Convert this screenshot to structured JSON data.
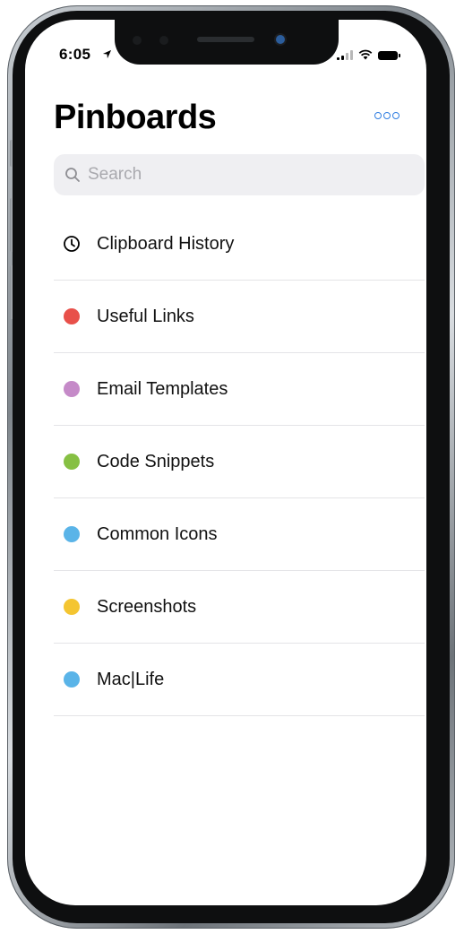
{
  "status_bar": {
    "time": "6:05"
  },
  "header": {
    "title": "Pinboards",
    "more_icon": "ellipsis-circle-icon",
    "accent_color": "#2f7de1"
  },
  "search": {
    "placeholder": "Search",
    "value": ""
  },
  "boards": [
    {
      "label": "Clipboard History",
      "icon": "clock-icon",
      "color": "#000000"
    },
    {
      "label": "Useful Links",
      "icon": "dot",
      "color": "#e8504a"
    },
    {
      "label": "Email Templates",
      "icon": "dot",
      "color": "#c58ac8"
    },
    {
      "label": "Code Snippets",
      "icon": "dot",
      "color": "#86c043"
    },
    {
      "label": "Common Icons",
      "icon": "dot",
      "color": "#5ab4e8"
    },
    {
      "label": "Screenshots",
      "icon": "dot",
      "color": "#f4c531"
    },
    {
      "label": "Mac|Life",
      "icon": "dot",
      "color": "#5ab4e8"
    }
  ]
}
